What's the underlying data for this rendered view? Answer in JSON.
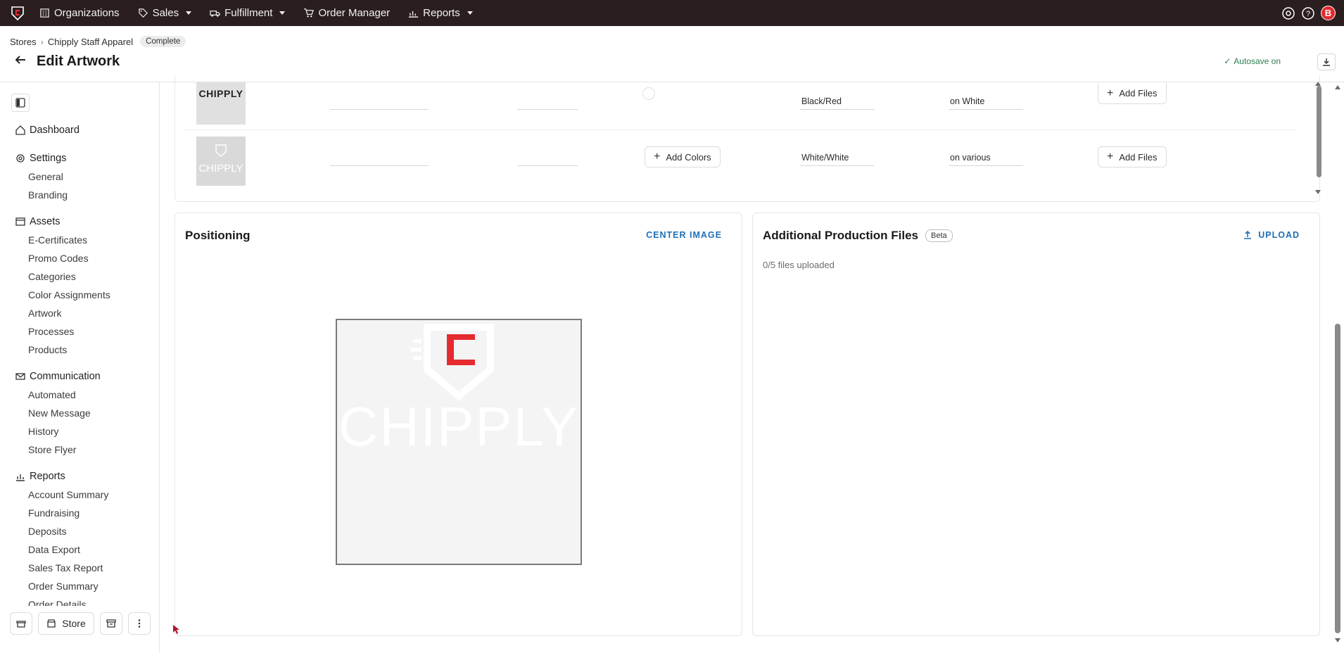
{
  "topnav": {
    "items": [
      {
        "label": "Organizations",
        "icon": "building-icon",
        "dropdown": false
      },
      {
        "label": "Sales",
        "icon": "tag-icon",
        "dropdown": true
      },
      {
        "label": "Fulfillment",
        "icon": "truck-icon",
        "dropdown": true
      },
      {
        "label": "Order Manager",
        "icon": "cart-icon",
        "dropdown": false
      },
      {
        "label": "Reports",
        "icon": "chart-icon",
        "dropdown": true
      }
    ],
    "avatar_initial": "B"
  },
  "header": {
    "breadcrumb": [
      "Stores",
      "Chipply Staff Apparel"
    ],
    "status_badge": "Complete",
    "title": "Edit Artwork",
    "autosave": "Autosave on"
  },
  "sidebar": {
    "sections": [
      {
        "label": "Dashboard",
        "icon": "home-icon",
        "items": []
      },
      {
        "label": "Settings",
        "icon": "gear-icon",
        "items": [
          "General",
          "Branding"
        ]
      },
      {
        "label": "Assets",
        "icon": "assets-icon",
        "items": [
          "E-Certificates",
          "Promo Codes",
          "Categories",
          "Color Assignments",
          "Artwork",
          "Processes",
          "Products"
        ]
      },
      {
        "label": "Communication",
        "icon": "mail-icon",
        "items": [
          "Automated",
          "New Message",
          "History",
          "Store Flyer"
        ]
      },
      {
        "label": "Reports",
        "icon": "chart-icon",
        "items": [
          "Account Summary",
          "Fundraising",
          "Deposits",
          "Data Export",
          "Sales Tax Report",
          "Order Summary",
          "Order Details"
        ]
      }
    ],
    "bottom_store_label": "Store"
  },
  "artwork_rows": [
    {
      "thumb_text": "CHIPPLY",
      "colors_label": "",
      "color_name": "Black/Red",
      "background": "on White",
      "add_files": "Add Files"
    },
    {
      "thumb_text": "CHIPPLY",
      "colors_label": "Add Colors",
      "color_name": "White/White",
      "background": "on various",
      "add_files": "Add Files"
    }
  ],
  "positioning": {
    "title": "Positioning",
    "center_label": "CENTER IMAGE",
    "logo_text": "CHIPPLY"
  },
  "production_files": {
    "title": "Additional Production Files",
    "beta_label": "Beta",
    "upload_label": "UPLOAD",
    "count_text": "0/5 files uploaded"
  },
  "colors": {
    "nav_bg": "#2a1e1f",
    "accent_red": "#e52b2f",
    "link_blue": "#1d6fb5",
    "autosave_green": "#2e7d4f"
  }
}
